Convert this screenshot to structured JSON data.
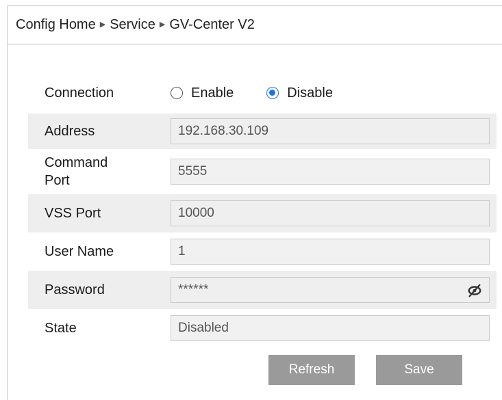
{
  "breadcrumb": {
    "items": [
      "Config Home",
      "Service",
      "GV-Center V2"
    ],
    "separator": "▶"
  },
  "form": {
    "connection": {
      "label": "Connection",
      "options": [
        "Enable",
        "Disable"
      ],
      "selected": "Disable"
    },
    "address": {
      "label": "Address",
      "value": "192.168.30.109"
    },
    "command_port": {
      "label": "Command Port",
      "value": "5555"
    },
    "vss_port": {
      "label": "VSS Port",
      "value": "10000"
    },
    "user_name": {
      "label": "User Name",
      "value": "1"
    },
    "password": {
      "label": "Password",
      "value": "******",
      "icon": "eye-slash-icon"
    },
    "state": {
      "label": "State",
      "value": "Disabled"
    }
  },
  "actions": {
    "refresh_label": "Refresh",
    "save_label": "Save"
  },
  "colors": {
    "button_bg": "#9a9a9a",
    "radio_accent": "#1a73e8",
    "row_shade": "#eeeeee"
  }
}
